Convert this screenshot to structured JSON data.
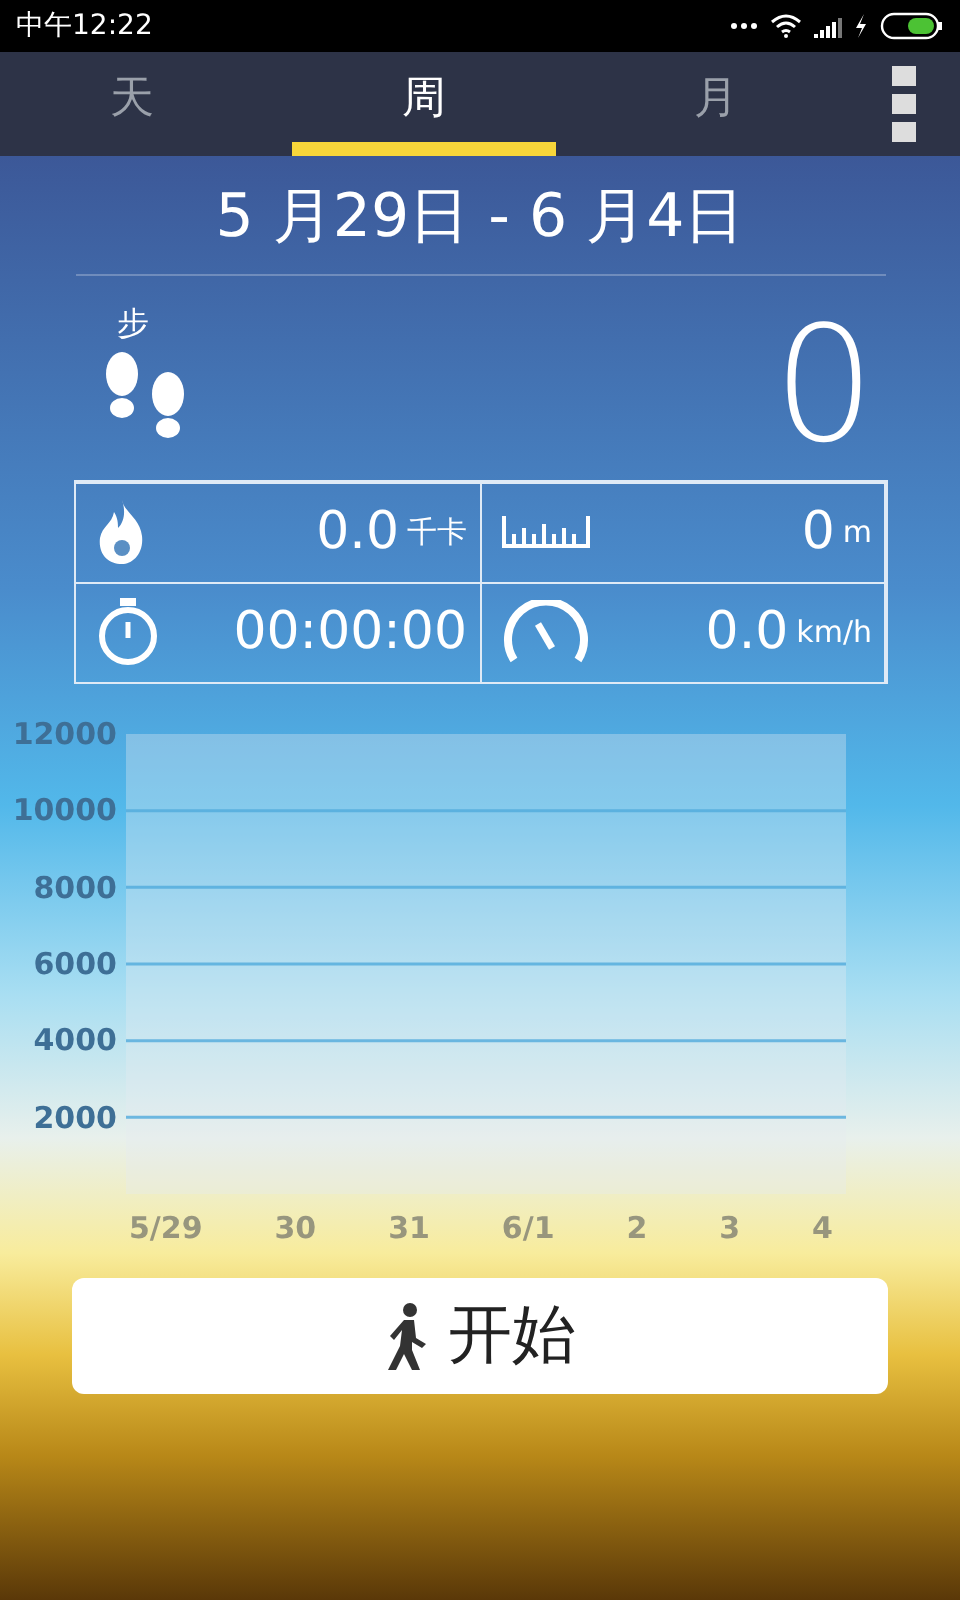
{
  "status_bar": {
    "time": "中午12:22"
  },
  "tabs": [
    {
      "label": "天",
      "selected": false
    },
    {
      "label": "周",
      "selected": true
    },
    {
      "label": "月",
      "selected": false
    }
  ],
  "date_range": "5 月29日 - 6 月4日",
  "steps": {
    "label": "步",
    "value": "0"
  },
  "stats": [
    {
      "kind": "calories",
      "value": "0.0",
      "unit": "千卡"
    },
    {
      "kind": "distance",
      "value": "0",
      "unit": "m"
    },
    {
      "kind": "duration",
      "value": "00:00:00"
    },
    {
      "kind": "speed",
      "value": "0.0",
      "unit": "km/h"
    }
  ],
  "chart": {
    "chart_data": {
      "type": "bar",
      "categories": [
        "5/29",
        "30",
        "31",
        "6/1",
        "2",
        "3",
        "4"
      ],
      "values": [
        0,
        0,
        0,
        0,
        0,
        0,
        0
      ],
      "ylim": [
        0,
        12000
      ],
      "grid": true,
      "yticks": [
        2000,
        4000,
        6000,
        8000,
        10000,
        12000
      ]
    }
  },
  "start_button": {
    "label": "开始"
  }
}
